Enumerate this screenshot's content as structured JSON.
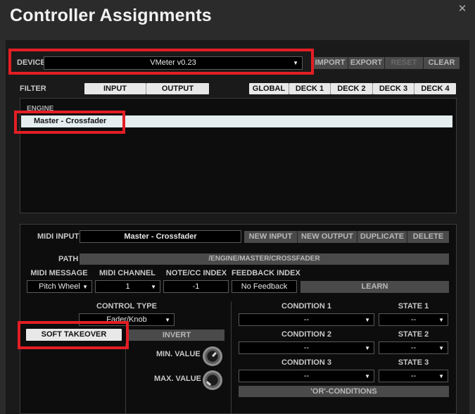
{
  "window": {
    "title": "Controller Assignments",
    "close_glyph": "✕"
  },
  "device": {
    "label": "DEVICE",
    "value": "VMeter v0.23",
    "buttons": [
      "IMPORT",
      "EXPORT",
      "RESET",
      "CLEAR"
    ]
  },
  "filter": {
    "label": "FILTER",
    "type_buttons": [
      "INPUT",
      "OUTPUT"
    ],
    "deck_buttons": [
      "GLOBAL",
      "DECK 1",
      "DECK 2",
      "DECK 3",
      "DECK 4"
    ]
  },
  "assignment_list": {
    "group": "ENGINE",
    "items": [
      "Master - Crossfader"
    ]
  },
  "midi": {
    "input_label": "MIDI INPUT",
    "input_value": "Master - Crossfader",
    "buttons": [
      "NEW INPUT",
      "NEW OUTPUT",
      "DUPLICATE",
      "DELETE"
    ],
    "path_label": "PATH",
    "path_value": "/ENGINE/MASTER/CROSSFADER",
    "message_label": "MIDI MESSAGE",
    "message_value": "Pitch Wheel",
    "channel_label": "MIDI CHANNEL",
    "channel_value": "1",
    "note_label": "NOTE/CC INDEX",
    "note_value": "-1",
    "feedback_label": "FEEDBACK INDEX",
    "feedback_value": "No Feedback",
    "learn_label": "LEARN"
  },
  "control": {
    "type_label": "CONTROL TYPE",
    "type_value": "Fader/Knob",
    "soft_takeover": "SOFT TAKEOVER",
    "invert": "INVERT",
    "min_label": "MIN. VALUE",
    "max_label": "MAX. VALUE"
  },
  "conditions": {
    "rows": [
      {
        "condition_label": "CONDITION 1",
        "condition_value": "--",
        "state_label": "STATE 1",
        "state_value": "--"
      },
      {
        "condition_label": "CONDITION 2",
        "condition_value": "--",
        "state_label": "STATE 2",
        "state_value": "--"
      },
      {
        "condition_label": "CONDITION 3",
        "condition_value": "--",
        "state_label": "STATE 3",
        "state_value": "--"
      }
    ],
    "or_button": "'OR'-CONDITIONS"
  },
  "colors": {
    "highlight": "#e31e24",
    "selection": "#e4eeee",
    "background": "#1a1a1a"
  }
}
